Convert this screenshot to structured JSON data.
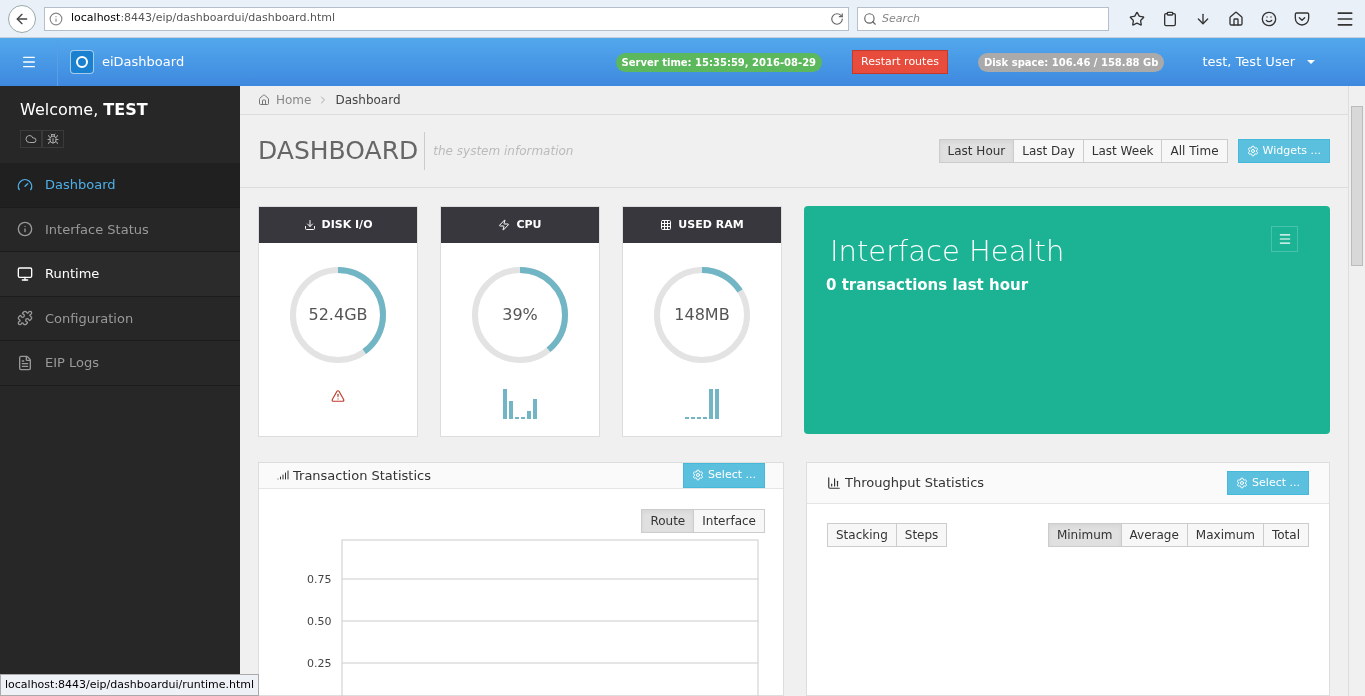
{
  "browser": {
    "url_host": "localhost",
    "url_path": ":8443/eip/dashboardui/dashboard.html",
    "search": {
      "placeholder": "Search"
    },
    "status_link": "localhost:8443/eip/dashboardui/runtime.html"
  },
  "header": {
    "brand": "eiDashboard",
    "server_time": "Server time: 15:35:59, 2016-08-29",
    "restart": "Restart routes",
    "disk_space": "Disk space: 106.46 / 158.88 Gb",
    "user": "test, Test User"
  },
  "sidebar": {
    "welcome": "Welcome, ",
    "user": "TEST",
    "items": [
      {
        "label": "Dashboard",
        "kind": "dashboard",
        "selected": true,
        "hovered": false
      },
      {
        "label": "Interface Status",
        "kind": "info",
        "selected": false,
        "hovered": false
      },
      {
        "label": "Runtime",
        "kind": "monitor",
        "selected": false,
        "hovered": true
      },
      {
        "label": "Configuration",
        "kind": "puzzle",
        "selected": false,
        "hovered": false
      },
      {
        "label": "EIP Logs",
        "kind": "file",
        "selected": false,
        "hovered": false
      }
    ]
  },
  "breadcrumb": [
    "Home",
    "Dashboard"
  ],
  "page": {
    "title": "DASHBOARD",
    "subtitle": "the system information",
    "ranges": [
      {
        "label": "Last Hour",
        "selected": true
      },
      {
        "label": "Last Day",
        "selected": false
      },
      {
        "label": "Last Week",
        "selected": false
      },
      {
        "label": "All Time",
        "selected": false
      }
    ],
    "widgets": "Widgets ..."
  },
  "gauges": [
    {
      "title": "DISK I/O",
      "kind": "disk",
      "value": "52.4GB",
      "level": 0.4,
      "alert": true
    },
    {
      "title": "CPU",
      "kind": "cpu",
      "value": "39%",
      "level": 0.39,
      "alert": false
    },
    {
      "title": "USED RAM",
      "kind": "ram",
      "value": "148MB",
      "level": 0.16,
      "alert": false
    }
  ],
  "health": {
    "title": "Interface Health",
    "subtitle": "0 transactions last hour"
  },
  "transaction": {
    "title": "Transaction Statistics",
    "select": "Select ...",
    "toggles": [
      {
        "label": "Route",
        "selected": true
      },
      {
        "label": "Interface",
        "selected": false
      }
    ],
    "axis_labels": [
      "0.75",
      "0.50",
      "0.25"
    ]
  },
  "throughput": {
    "title": "Throughput Statistics",
    "select": "Select ...",
    "modes": [
      {
        "label": "Stacking",
        "selected": false
      },
      {
        "label": "Steps",
        "selected": false
      }
    ],
    "measures": [
      {
        "label": "Minimum",
        "selected": true
      },
      {
        "label": "Average",
        "selected": false
      },
      {
        "label": "Maximum",
        "selected": false
      },
      {
        "label": "Total",
        "selected": false
      }
    ]
  }
}
